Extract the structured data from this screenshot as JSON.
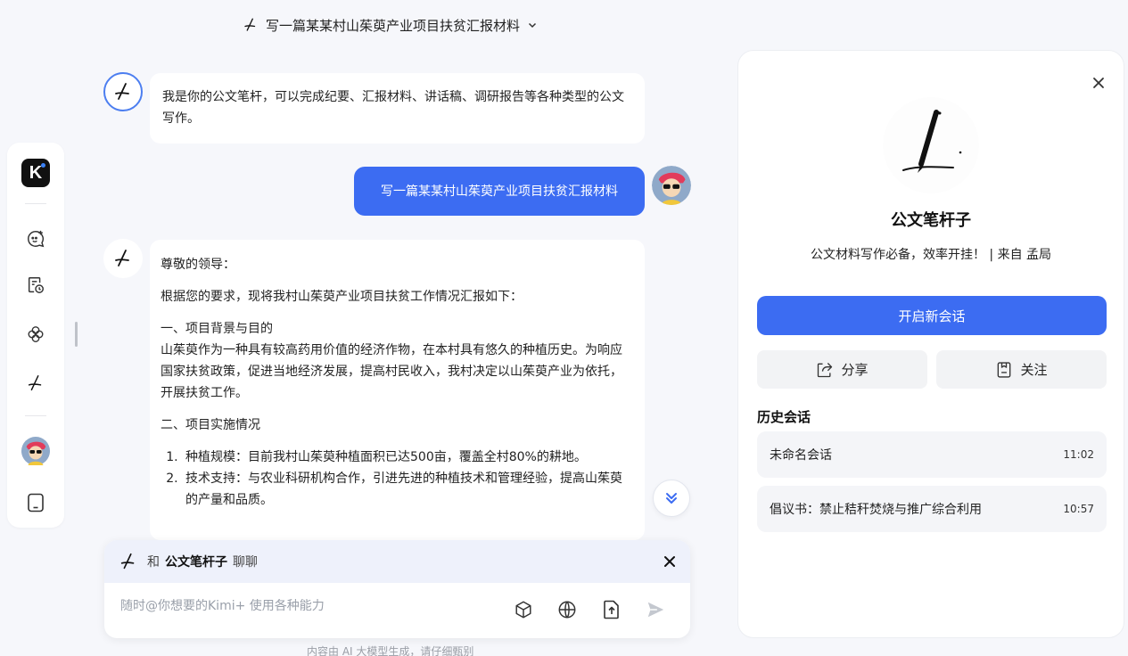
{
  "header": {
    "title": "写一篇某某村山茱萸产业项目扶贫汇报材料"
  },
  "sidebar": {
    "logo_text": "K"
  },
  "chat": {
    "intro_message": "我是你的公文笔杆，可以完成纪要、汇报材料、讲话稿、调研报告等各种类型的公文写作。",
    "user_message": "写一篇某某村山茱萸产业项目扶贫汇报材料",
    "response": {
      "greeting": "尊敬的领导：",
      "intro": "根据您的要求，现将我村山茱萸产业项目扶贫工作情况汇报如下：",
      "section1_title": "一、项目背景与目的",
      "section1_body": "山茱萸作为一种具有较高药用价值的经济作物，在本村具有悠久的种植历史。为响应国家扶贫政策，促进当地经济发展，提高村民收入，我村决定以山茱萸产业为依托，开展扶贫工作。",
      "section2_title": "二、项目实施情况",
      "items": [
        "种植规模：目前我村山茱萸种植面积已达500亩，覆盖全村80%的耕地。",
        "技术支持：与农业科研机构合作，引进先进的种植技术和管理经验，提高山茱萸的产量和品质。"
      ]
    }
  },
  "composer": {
    "prefix": "和",
    "agent_name": "公文笔杆子",
    "suffix": "聊聊",
    "placeholder": "随时@你想要的Kimi+ 使用各种能力"
  },
  "footer_note": "内容由 AI 大模型生成，请仔细甄别",
  "panel": {
    "agent_name": "公文笔杆子",
    "description": "公文材料写作必备，效率开挂！ | 来自 孟局",
    "new_chat_label": "开启新会话",
    "share_label": "分享",
    "follow_label": "关注",
    "history_title": "历史会话",
    "history": [
      {
        "title": "未命名会话",
        "time": "11:02"
      },
      {
        "title": "倡议书：禁止秸秆焚烧与推广综合利用",
        "time": "10:57"
      }
    ]
  },
  "colors": {
    "accent": "#3c6cf2",
    "background": "#f6f7fb"
  }
}
